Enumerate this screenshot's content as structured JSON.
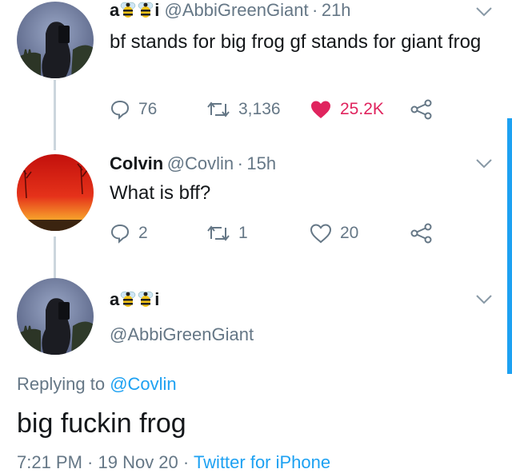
{
  "tweets": [
    {
      "display_name_prefix": "a",
      "display_name_suffix": "i",
      "handle": "@AbbiGreenGiant",
      "time": "21h",
      "text": "bf stands for big frog gf stands for giant frog",
      "replies": "76",
      "retweets": "3,136",
      "likes": "25.2K",
      "liked": true
    },
    {
      "display_name": "Colvin",
      "handle": "@Covlin",
      "time": "15h",
      "text": "What is bff?",
      "replies": "2",
      "retweets": "1",
      "likes": "20",
      "liked": false
    }
  ],
  "focused": {
    "display_name_prefix": "a",
    "display_name_suffix": "i",
    "handle": "@AbbiGreenGiant",
    "replying_prefix": "Replying to ",
    "replying_handle": "@Covlin",
    "text": "big fuckin frog",
    "meta_time": "7:21 PM · 19 Nov 20 · ",
    "meta_client": "Twitter for iPhone"
  },
  "separator": "·",
  "colors": {
    "link": "#1da1f2",
    "muted": "#657786",
    "like_active": "#e0245e",
    "thread_line": "#ccd6dd"
  },
  "icons": [
    "reply-icon",
    "retweet-icon",
    "like-icon",
    "share-icon",
    "chevron-down-icon",
    "bee-emoji"
  ]
}
